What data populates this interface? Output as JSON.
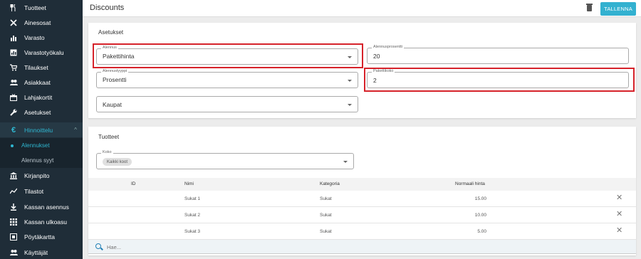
{
  "sidebar": {
    "items": [
      {
        "label": "Tuotteet",
        "icon": "cutlery-icon"
      },
      {
        "label": "Ainesosat",
        "icon": "tools-icon"
      },
      {
        "label": "Varasto",
        "icon": "bar-chart-icon"
      },
      {
        "label": "Varastotyökalu",
        "icon": "report-icon"
      },
      {
        "label": "Tilaukset",
        "icon": "cart-icon"
      },
      {
        "label": "Asiakkaat",
        "icon": "people-icon"
      },
      {
        "label": "Lahjakortit",
        "icon": "gift-card-icon"
      },
      {
        "label": "Asetukset",
        "icon": "wrench-icon"
      },
      {
        "label": "Hinnoittelu",
        "icon": "euro-icon"
      },
      {
        "label": "Kirjanpito",
        "icon": "bank-icon"
      },
      {
        "label": "Tilastot",
        "icon": "line-chart-icon"
      },
      {
        "label": "Kassan asennus",
        "icon": "download-icon"
      },
      {
        "label": "Kassan ulkoasu",
        "icon": "grid-icon"
      },
      {
        "label": "Pöytäkartta",
        "icon": "table-map-icon"
      },
      {
        "label": "Käyttäjät",
        "icon": "people-icon"
      }
    ],
    "subitems": [
      {
        "label": "Alennukset"
      },
      {
        "label": "Alennus syyt"
      }
    ]
  },
  "header": {
    "title": "Discounts",
    "save_label": "TALLENNA"
  },
  "settings": {
    "title": "Asetukset",
    "alennus": {
      "label": "Alennus",
      "value": "Pakettihinta"
    },
    "alennusprosentti": {
      "label": "Alennusprosentti",
      "value": "20"
    },
    "alennustyyppi": {
      "label": "Alennustyyppi",
      "value": "Prosentti"
    },
    "pakettikoko": {
      "label": "Pakettikoko",
      "value": "2"
    },
    "kaupat": {
      "placeholder": "Kaupat"
    }
  },
  "products": {
    "title": "Tuotteet",
    "koko": {
      "label": "Koko",
      "chip": "Kaikki koot"
    },
    "columns": [
      "ID",
      "Nimi",
      "Kategoria",
      "Normaali hinta"
    ],
    "rows": [
      {
        "id": "",
        "name": "Sukat 1",
        "category": "Sukat",
        "price": "15.00"
      },
      {
        "id": "",
        "name": "Sukat 2",
        "category": "Sukat",
        "price": "10.00"
      },
      {
        "id": "",
        "name": "Sukat 3",
        "category": "Sukat",
        "price": "5.00"
      }
    ],
    "search_placeholder": "Hae..."
  },
  "colors": {
    "sidebar_bg": "#1f2d38",
    "accent": "#33b1d0",
    "highlight": "#d6222a"
  }
}
